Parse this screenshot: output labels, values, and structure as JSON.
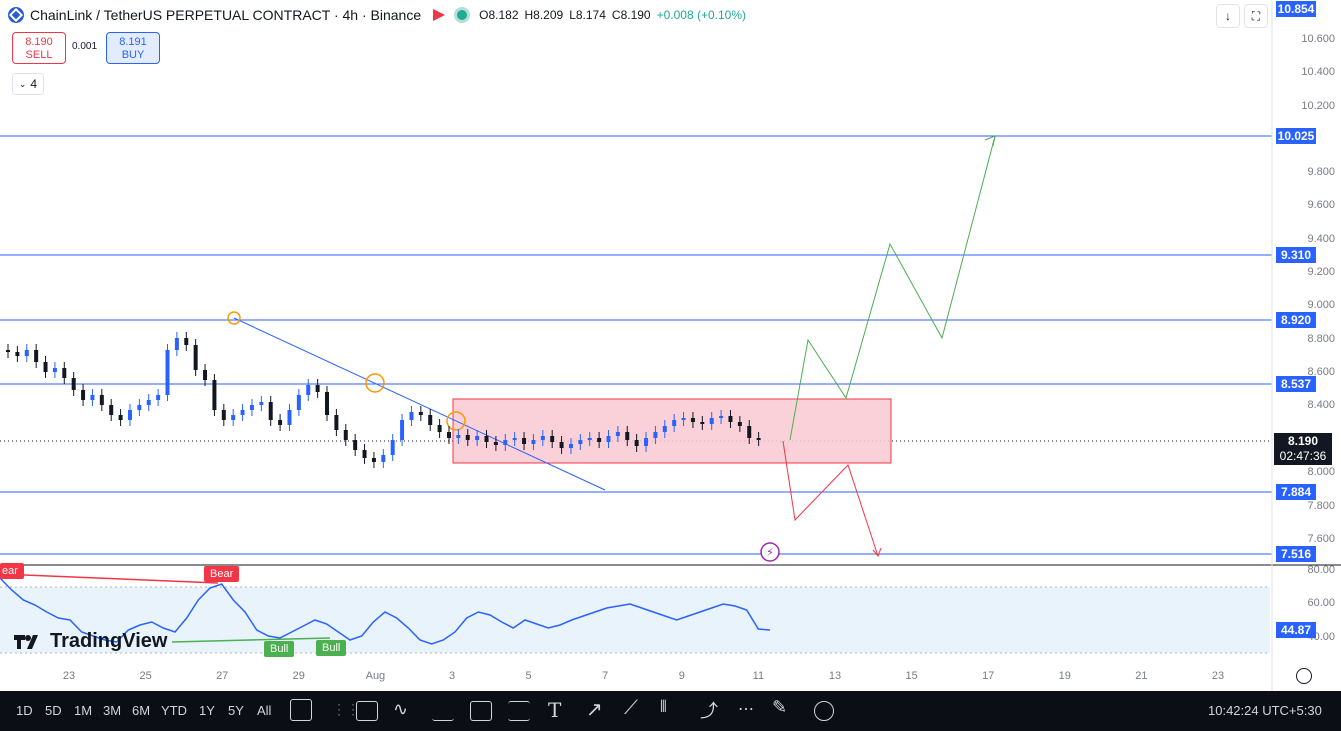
{
  "header": {
    "title": "ChainLink / TetherUS PERPETUAL CONTRACT · 4h · Binance",
    "ohlc": {
      "o": "O8.182",
      "h": "H8.209",
      "l": "L8.174",
      "c": "C8.190",
      "chg": "+0.008 (+0.10%)"
    }
  },
  "trade": {
    "sell_price": "8.190",
    "sell_label": "SELL",
    "spread": "0.001",
    "buy_price": "8.191",
    "buy_label": "BUY"
  },
  "indicator_count": "4",
  "price_axis": {
    "ticks": [
      "10.600",
      "10.400",
      "10.200",
      "9.800",
      "9.600",
      "9.400",
      "9.200",
      "9.000",
      "8.800",
      "8.600",
      "8.400",
      "8.000",
      "7.800",
      "7.600"
    ],
    "levels": [
      "10.854",
      "10.025",
      "9.310",
      "8.920",
      "8.537",
      "7.884",
      "7.516"
    ],
    "current_price": "8.190",
    "countdown": "02:47:36"
  },
  "rsi_axis": {
    "ticks": [
      "80.00",
      "60.00",
      "40.00"
    ],
    "current": "44.87"
  },
  "rsi_labels": {
    "bear": "Bear",
    "bear_partial": "ear",
    "bull1": "Bull",
    "bull2": "Bull"
  },
  "tv_logo": "TradingView",
  "time_axis": [
    "23",
    "25",
    "27",
    "29",
    "Aug",
    "3",
    "5",
    "7",
    "9",
    "11",
    "13",
    "15",
    "17",
    "19",
    "21",
    "23"
  ],
  "bottom_bar": {
    "timeframes": [
      "1D",
      "5D",
      "1M",
      "3M",
      "6M",
      "YTD",
      "1Y",
      "5Y",
      "All"
    ],
    "clock": "10:42:24 UTC+5:30"
  },
  "colors": {
    "accent": "#2962ff",
    "bull": "#22ab94",
    "bear": "#f23645",
    "zone": "#f9c9d1",
    "rsi": "#2962ff"
  }
}
